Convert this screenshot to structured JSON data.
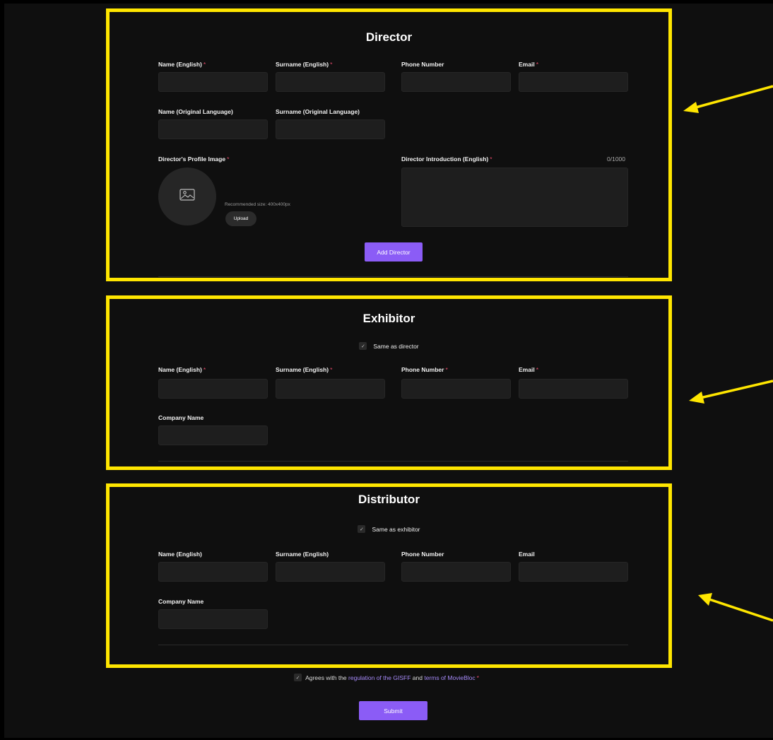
{
  "director": {
    "title": "Director",
    "name_en_label": "Name (English)",
    "surname_en_label": "Surname (English)",
    "phone_label": "Phone Number",
    "email_label": "Email",
    "name_orig_label": "Name (Original Language)",
    "surname_orig_label": "Surname (Original Language)",
    "profile_image_label": "Director's Profile Image",
    "recommended_size": "Recommended size: 400x400px",
    "upload_label": "Upload",
    "intro_label": "Director Introduction (English)",
    "intro_counter": "0/1000",
    "add_button": "Add Director",
    "required_mark": "*"
  },
  "exhibitor": {
    "title": "Exhibitor",
    "same_as_label": "Same as director",
    "name_en_label": "Name (English)",
    "surname_en_label": "Surname (English)",
    "phone_label": "Phone Number",
    "email_label": "Email",
    "company_label": "Company Name",
    "required_mark": "*"
  },
  "distributor": {
    "title": "Distributor",
    "same_as_label": "Same as exhibitor",
    "name_en_label": "Name (English)",
    "surname_en_label": "Surname (English)",
    "phone_label": "Phone Number",
    "email_label": "Email",
    "company_label": "Company Name"
  },
  "agreement": {
    "prefix": "Agrees with the",
    "link1": "regulation of the GISFF",
    "middle": "and",
    "link2": "terms of MovieBloc",
    "required_mark": "*"
  },
  "submit_label": "Submit",
  "icons": {
    "checkbox": "check-icon",
    "image_placeholder": "image-icon",
    "arrow": "arrow-icon"
  },
  "colors": {
    "highlight_border": "#ffe600",
    "accent": "#8b5cf6",
    "required": "#e54a6a",
    "link": "#a78bfa"
  }
}
